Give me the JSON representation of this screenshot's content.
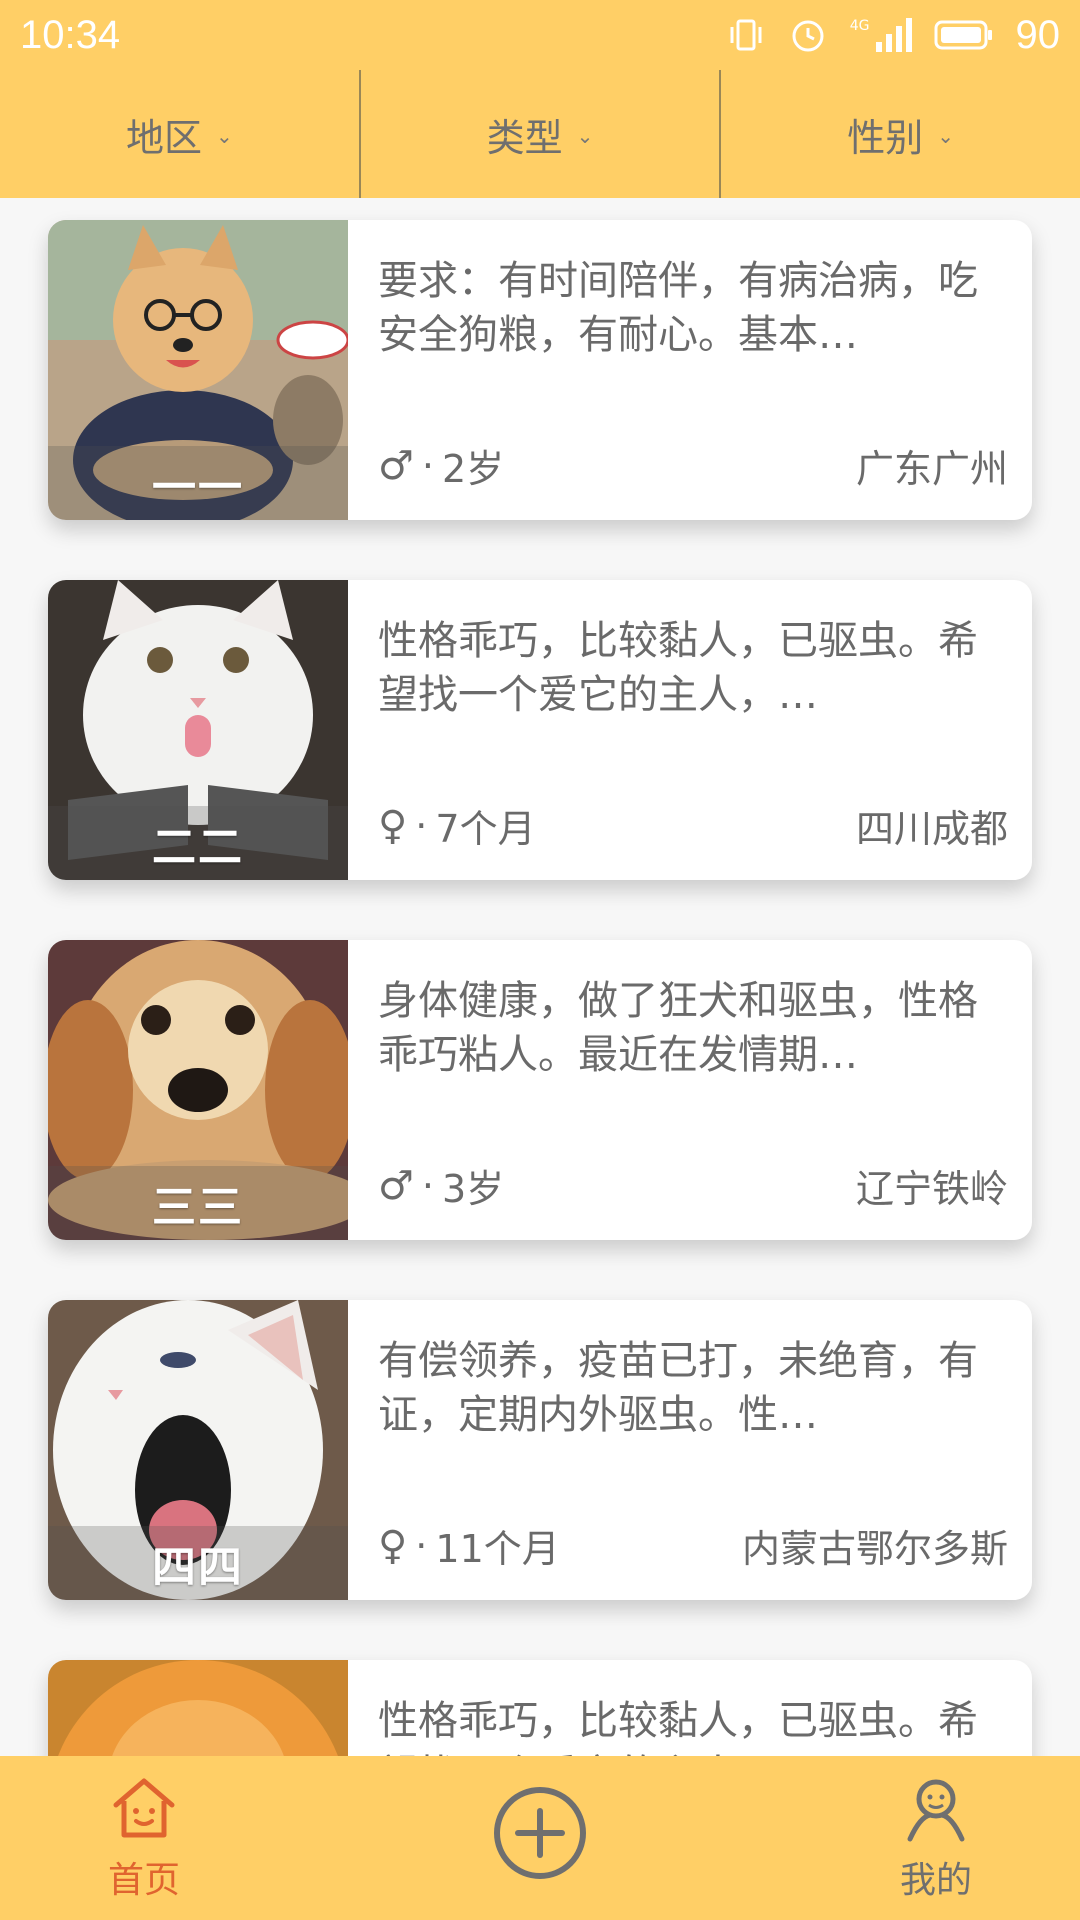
{
  "status_bar": {
    "time": "10:34",
    "network": "4G",
    "battery": "90"
  },
  "filters": [
    {
      "label": "地区"
    },
    {
      "label": "类型"
    },
    {
      "label": "性别"
    }
  ],
  "pets": [
    {
      "name": "一一",
      "description": "要求：有时间陪伴，有病治病，吃安全狗粮，有耐心。基本…",
      "gender_symbol": "♂",
      "age": "2岁",
      "location": "广东广州",
      "kind": "dog"
    },
    {
      "name": "二二",
      "description": "性格乖巧，比较黏人，已驱虫。希望找一个爱它的主人，…",
      "gender_symbol": "♀",
      "age": "7个月",
      "location": "四川成都",
      "kind": "cat"
    },
    {
      "name": "三三",
      "description": "身体健康，做了狂犬和驱虫，性格乖巧粘人。最近在发情期…",
      "gender_symbol": "♂",
      "age": "3岁",
      "location": "辽宁铁岭",
      "kind": "dog"
    },
    {
      "name": "四四",
      "description": "有偿领养，疫苗已打，未绝育，有证，定期内外驱虫。性…",
      "gender_symbol": "♀",
      "age": "11个月",
      "location": "内蒙古鄂尔多斯",
      "kind": "cat"
    },
    {
      "name": "",
      "description": "性格乖巧，比较黏人，已驱虫。希望找一个爱它的主人，…",
      "gender_symbol": "",
      "age": "",
      "location": "",
      "kind": "dog"
    }
  ],
  "tabs": {
    "home": "首页",
    "mine": "我的"
  },
  "colors": {
    "accent": "#ffcf66",
    "active_tab": "#e0642f",
    "text": "#6a6a6a"
  }
}
